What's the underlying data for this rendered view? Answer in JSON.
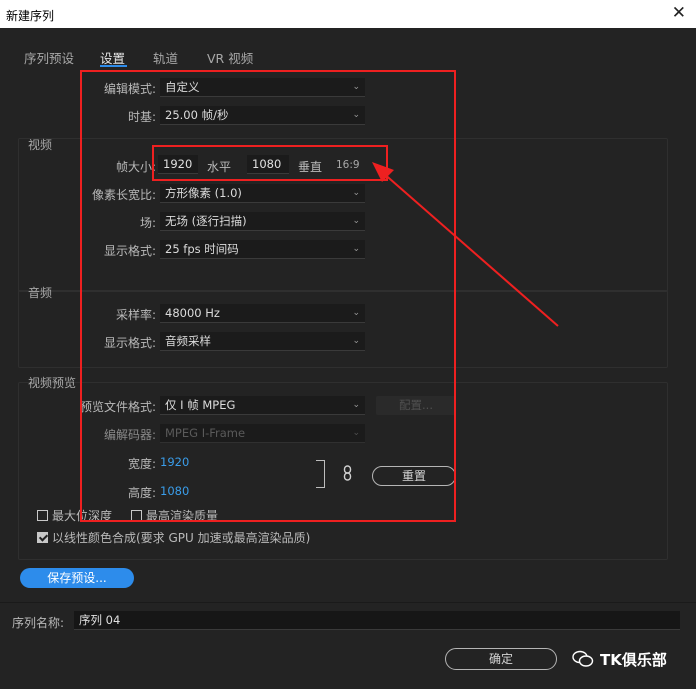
{
  "window": {
    "title": "新建序列",
    "close_glyph": "✕"
  },
  "tabs": [
    "序列预设",
    "设置",
    "轨道",
    "VR 视频"
  ],
  "editing_mode": {
    "label": "编辑模式:",
    "value": "自定义"
  },
  "timebase": {
    "label": "时基:",
    "value": "25.00  帧/秒"
  },
  "video": {
    "section": "视频",
    "frame_size": {
      "label": "帧大小:",
      "width": "1920",
      "h_label": "水平",
      "height": "1080",
      "v_label": "垂直",
      "aspect": "16:9"
    },
    "pixel_aspect": {
      "label": "像素长宽比:",
      "value": "方形像素 (1.0)"
    },
    "fields": {
      "label": "场:",
      "value": "无场 (逐行扫描)"
    },
    "display_format": {
      "label": "显示格式:",
      "value": "25 fps 时间码"
    }
  },
  "audio": {
    "section": "音频",
    "sample_rate": {
      "label": "采样率:",
      "value": "48000 Hz"
    },
    "display_format": {
      "label": "显示格式:",
      "value": "音频采样"
    }
  },
  "preview": {
    "section": "视频预览",
    "file_format": {
      "label": "预览文件格式:",
      "value": "仅 I 帧 MPEG"
    },
    "config_button": "配置...",
    "codec": {
      "label": "编解码器:",
      "value": "MPEG I-Frame"
    },
    "width": {
      "label": "宽度:",
      "value": "1920"
    },
    "height": {
      "label": "高度:",
      "value": "1080"
    },
    "reset_button": "重置"
  },
  "options": {
    "max_bit_depth": {
      "label": "最大位深度",
      "checked": false
    },
    "max_render_quality": {
      "label": "最高渲染质量",
      "checked": false
    },
    "linear_color": {
      "label": "以线性颜色合成(要求 GPU 加速或最高渲染品质)",
      "checked": true
    }
  },
  "save_preset_button": "保存预设...",
  "sequence_name": {
    "label": "序列名称:",
    "value": "序列 04"
  },
  "ok_button": "确定",
  "watermark": "TK俱乐部",
  "colors": {
    "accent": "#2d8ceb",
    "annotation": "#ee2020",
    "background": "#232323"
  }
}
